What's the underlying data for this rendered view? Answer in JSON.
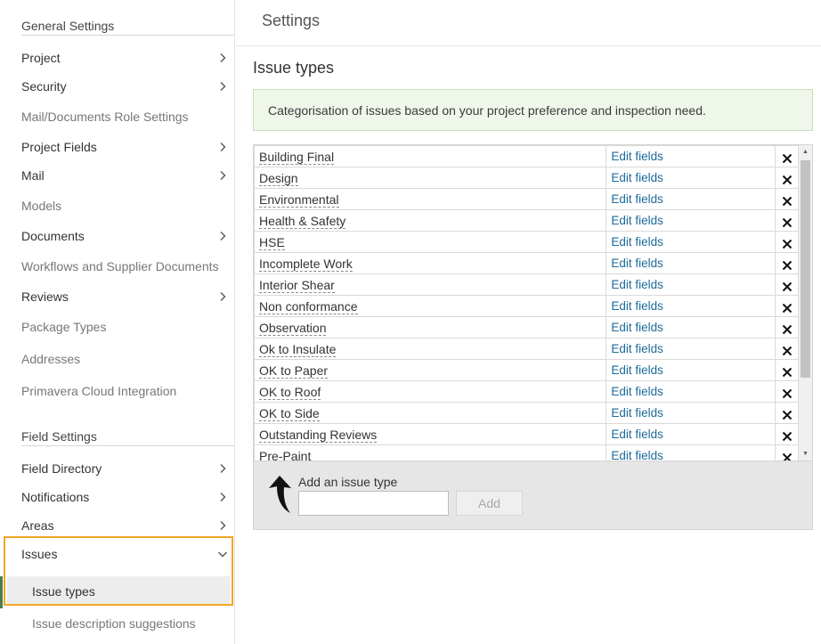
{
  "sidebar": {
    "general_heading": "General Settings",
    "general_items": [
      {
        "label": "Project",
        "expandable": true
      },
      {
        "label": "Security",
        "expandable": true
      },
      {
        "label": "Mail/Documents Role Settings",
        "expandable": false
      },
      {
        "label": "Project Fields",
        "expandable": true
      },
      {
        "label": "Mail",
        "expandable": true
      },
      {
        "label": "Models",
        "expandable": false
      },
      {
        "label": "Documents",
        "expandable": true
      },
      {
        "label": "Workflows and Supplier Documents",
        "expandable": false
      },
      {
        "label": "Reviews",
        "expandable": true
      },
      {
        "label": "Package Types",
        "expandable": false
      },
      {
        "label": "Addresses",
        "expandable": false
      },
      {
        "label": "Primavera Cloud Integration",
        "expandable": false
      }
    ],
    "field_heading": "Field Settings",
    "field_items": [
      {
        "label": "Field Directory",
        "expandable": true
      },
      {
        "label": "Notifications",
        "expandable": true
      },
      {
        "label": "Areas",
        "expandable": true
      },
      {
        "label": "Issues",
        "expandable": true,
        "expanded": true
      }
    ],
    "issues_sub_items": [
      {
        "label": "Issue types",
        "active": true
      },
      {
        "label": "Issue description suggestions",
        "active": false
      }
    ]
  },
  "main": {
    "header_title": "Settings",
    "page_title": "Issue types",
    "info_text": "Categorisation of issues based on your project preference and inspection need.",
    "edit_label": "Edit fields",
    "issue_types": [
      "Building Final",
      "Design",
      "Environmental",
      "Health & Safety",
      "HSE",
      "Incomplete Work",
      "Interior Shear",
      "Non conformance",
      "Observation",
      "Ok to Insulate",
      "OK to Paper",
      "OK to Roof",
      "OK to Side",
      "Outstanding Reviews",
      "Pre-Paint"
    ],
    "add_label": "Add an issue type",
    "add_input_value": "",
    "add_button_label": "Add"
  },
  "colors": {
    "highlight_border": "#f0a623",
    "link": "#1e6a9a",
    "info_bg": "#eff7ea",
    "active_marker": "#4e7a4c"
  },
  "icons": {
    "chevron": "chevron-right-icon",
    "chevron_expanded": "chevron-down-icon",
    "delete": "close-icon",
    "hint": "curved-arrow-icon"
  }
}
